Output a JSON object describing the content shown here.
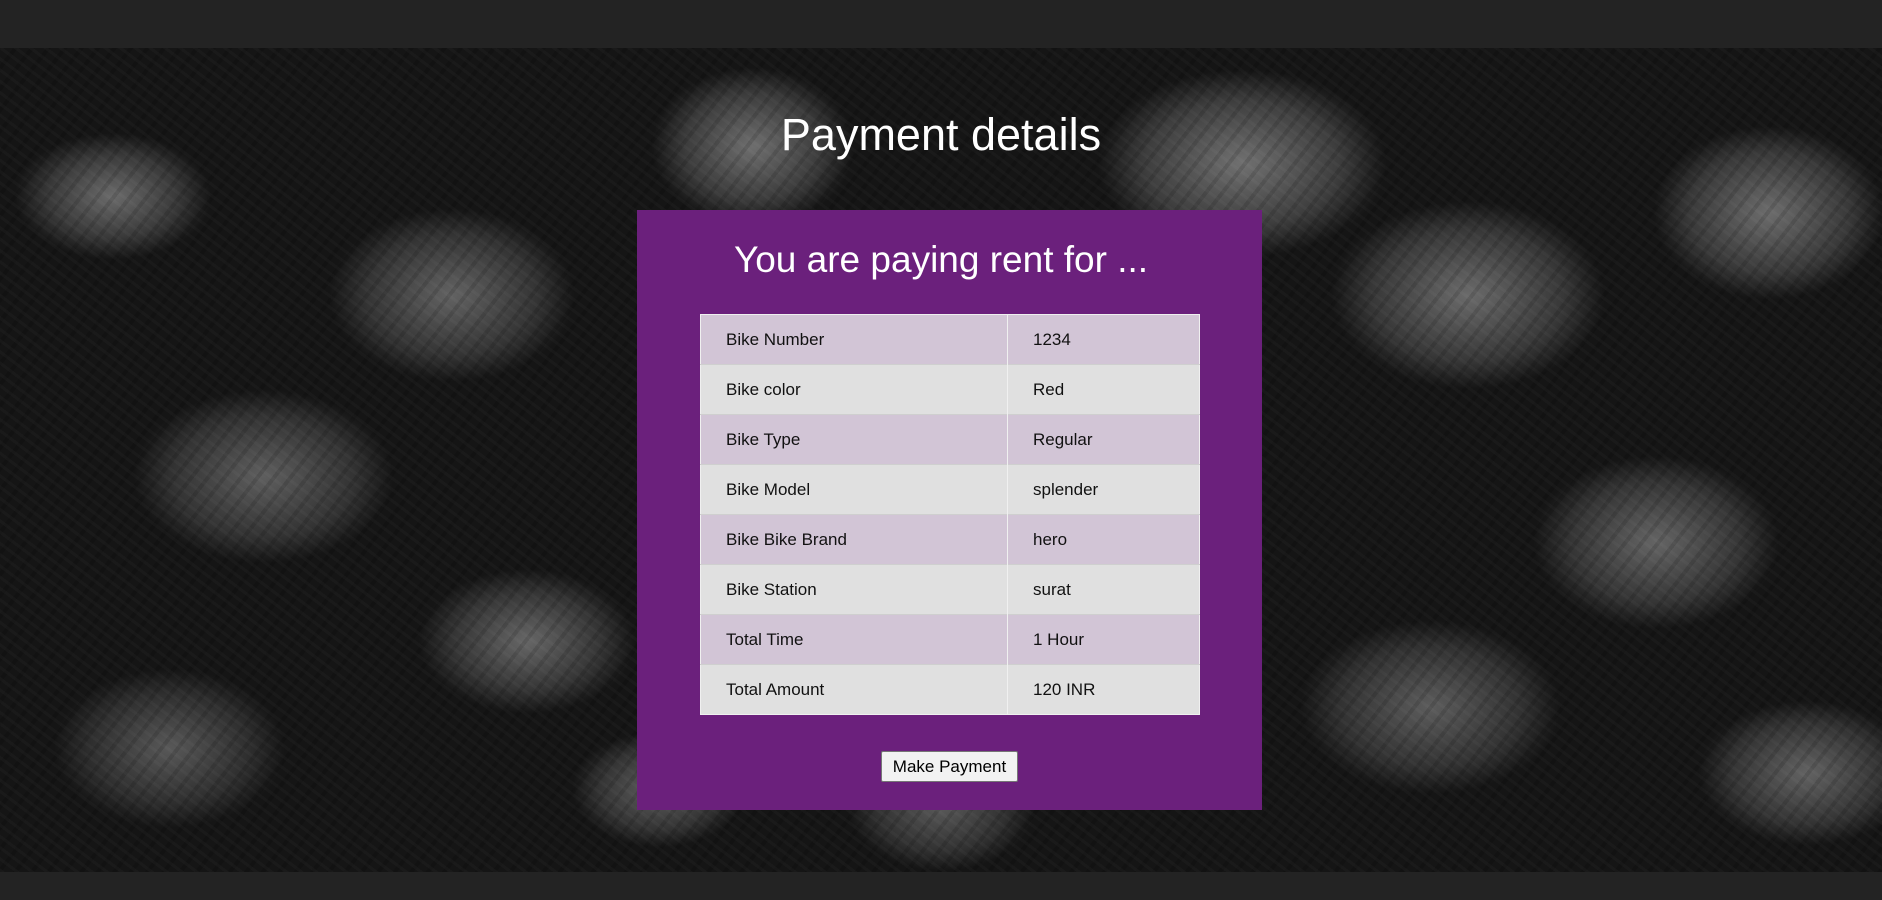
{
  "page": {
    "title": "Payment details"
  },
  "card": {
    "heading": "You are paying rent for ..."
  },
  "details": [
    {
      "label": "Bike Number",
      "value": "1234"
    },
    {
      "label": "Bike color",
      "value": "Red"
    },
    {
      "label": "Bike Type",
      "value": "Regular"
    },
    {
      "label": "Bike Model",
      "value": "splender"
    },
    {
      "label": "Bike Bike Brand",
      "value": "hero"
    },
    {
      "label": "Bike Station",
      "value": "surat"
    },
    {
      "label": "Total Time",
      "value": "1 Hour"
    },
    {
      "label": "Total Amount",
      "value": "120 INR"
    }
  ],
  "actions": {
    "pay_label": "Make Payment"
  },
  "colors": {
    "card_background": "#6b207c",
    "row_odd": "#d2c5d6",
    "row_even": "#e0e0e0",
    "page_frame": "#232323"
  }
}
